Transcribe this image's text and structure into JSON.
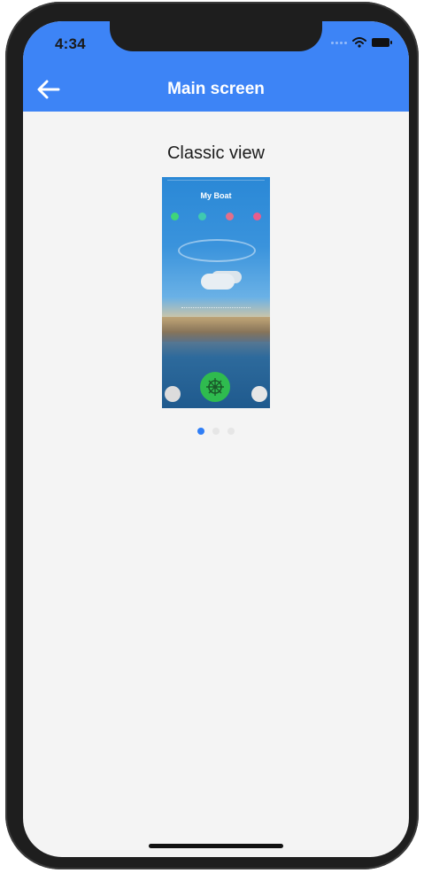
{
  "status_bar": {
    "time": "4:34"
  },
  "header": {
    "title": "Main screen",
    "back_icon": "arrow-left-icon"
  },
  "content": {
    "section_title": "Classic view",
    "preview": {
      "app_title": "My Boat"
    },
    "pager": {
      "count": 3,
      "active_index": 0
    }
  },
  "colors": {
    "header": "#3d84f6",
    "background": "#f4f4f4",
    "active_dot": "#2f7ef6",
    "inactive_dot": "#e6e6e6",
    "helm_button": "#2fbb4f"
  }
}
